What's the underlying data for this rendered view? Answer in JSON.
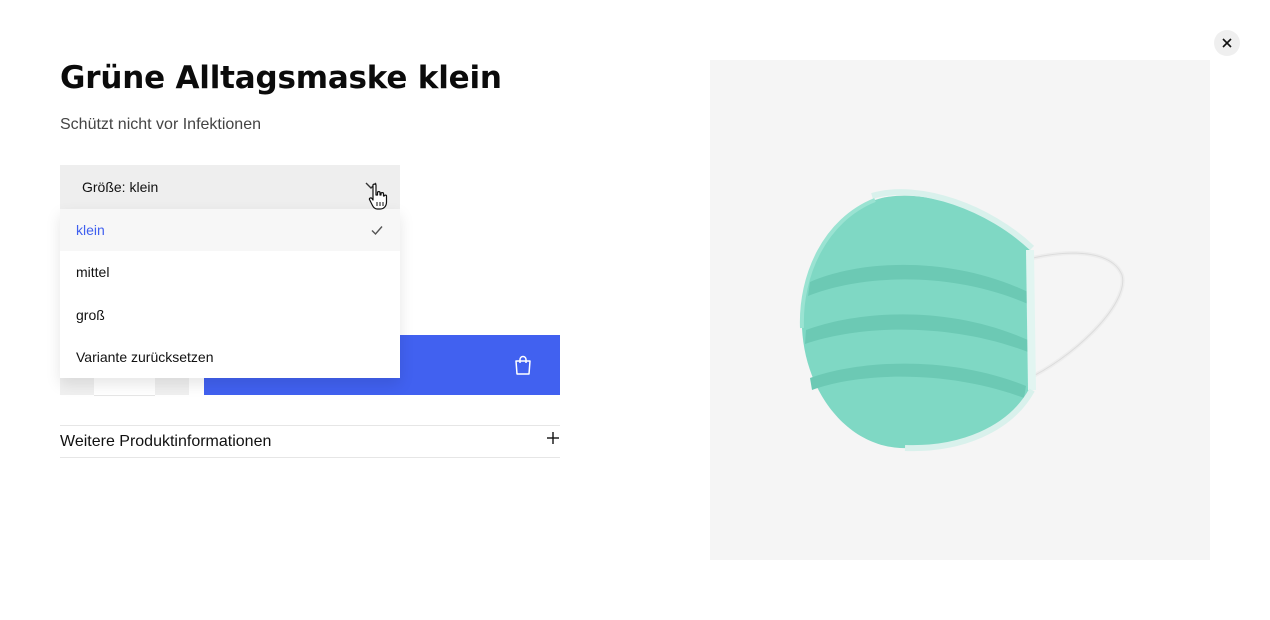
{
  "product": {
    "title": "Grüne Alltagsmaske klein",
    "subtitle": "Schützt nicht vor Infektionen"
  },
  "variant_select": {
    "label": "Größe:  klein",
    "selected": "klein",
    "options": [
      "klein",
      "mittel",
      "groß",
      "Variante zurücksetzen"
    ]
  },
  "accordion": {
    "label": "Weitere Produktinformationen"
  },
  "colors": {
    "accent": "#4161f0",
    "selected_text": "#4060ef",
    "image_background": "#f5f5f5",
    "mask": "#7fd8c4"
  },
  "icons": {
    "close": "close-icon",
    "chevron": "chevron-down-icon",
    "check": "check-icon",
    "bag": "shopping-bag-icon",
    "plus": "plus-icon",
    "cursor": "hand-pointer-icon"
  }
}
